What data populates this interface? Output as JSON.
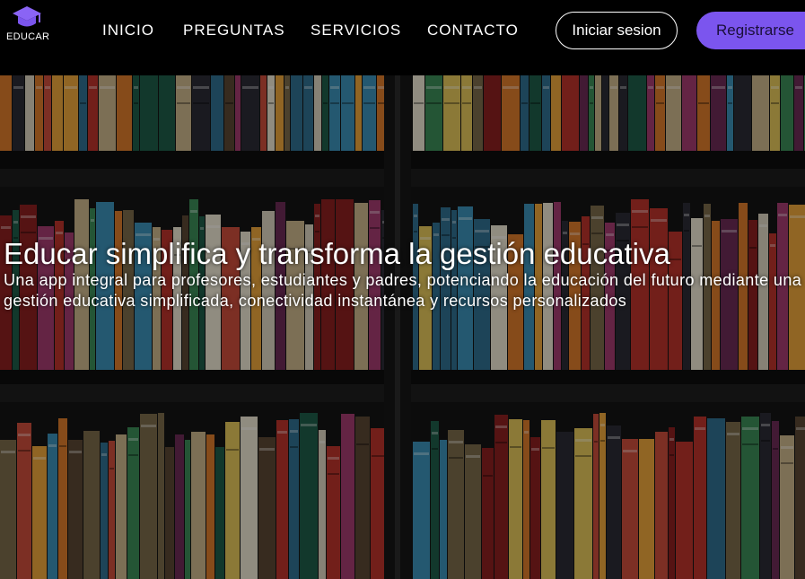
{
  "brand": {
    "name": "EDUCAR",
    "icon": "graduation-cap-icon",
    "accent": "#7b55ee"
  },
  "nav": {
    "items": [
      {
        "label": "INICIO"
      },
      {
        "label": "PREGUNTAS"
      },
      {
        "label": "SERVICIOS"
      },
      {
        "label": "CONTACTO"
      }
    ]
  },
  "auth": {
    "login_label": "Iniciar sesion",
    "register_label": "Registrarse"
  },
  "hero": {
    "title": "Educar simplifica y transforma la gestión educativa",
    "subtitle": "Una app integral para profesores, estudiantes y padres, potenciando la educación del futuro mediante una gestión educativa simplificada, conectividad instantánea y recursos personalizados",
    "background": "bookshelf-photo"
  }
}
